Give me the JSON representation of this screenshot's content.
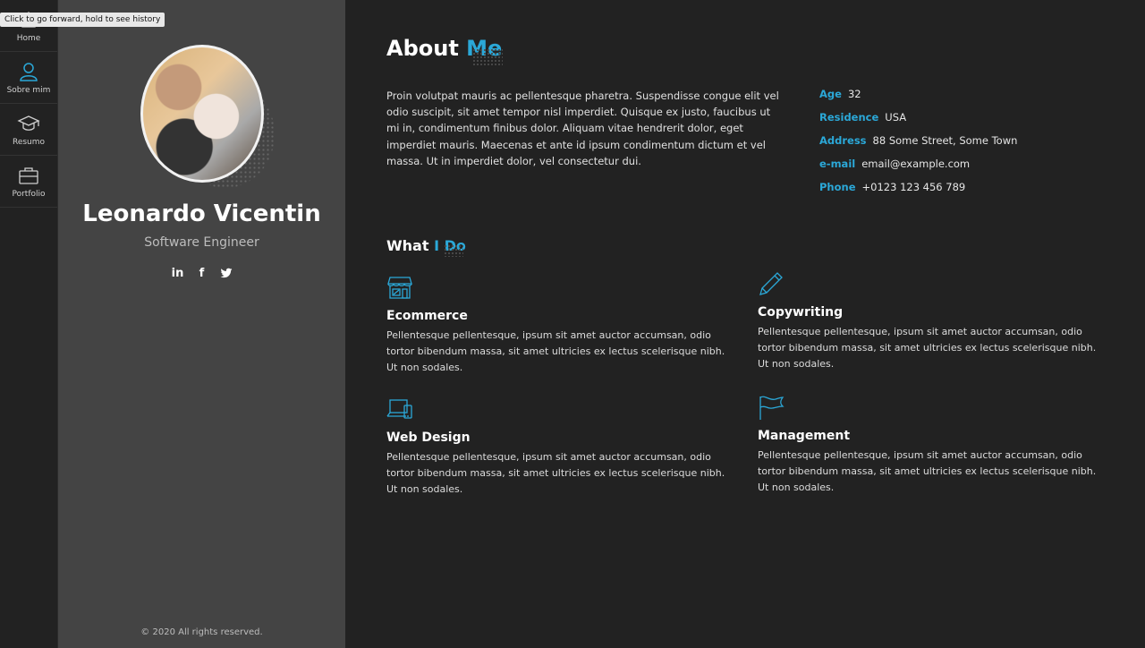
{
  "browser": {
    "tooltip": "Click to go forward, hold to see history"
  },
  "nav": {
    "items": [
      {
        "label": "Home",
        "icon": "home-icon"
      },
      {
        "label": "Sobre mim",
        "icon": "user-icon"
      },
      {
        "label": "Resumo",
        "icon": "graduation-cap-icon"
      },
      {
        "label": "Portfolio",
        "icon": "briefcase-icon"
      }
    ]
  },
  "profile": {
    "name": "Leonardo Vicentin",
    "role": "Software Engineer",
    "social": {
      "linkedin": "in",
      "facebook": "f",
      "twitter": "twitter-icon"
    },
    "copyright": "© 2020 All rights reserved."
  },
  "about": {
    "title_main": "About",
    "title_accent": "Me",
    "text": "Proin volutpat mauris ac pellentesque pharetra. Suspendisse congue elit vel odio suscipit, sit amet tempor nisl imperdiet. Quisque ex justo, faucibus ut mi in, condimentum finibus dolor. Aliquam vitae hendrerit dolor, eget imperdiet mauris. Maecenas et ante id ipsum condimentum dictum et vel massa. Ut in imperdiet dolor, vel consectetur dui.",
    "info": [
      {
        "key": "Age",
        "value": "32"
      },
      {
        "key": "Residence",
        "value": "USA"
      },
      {
        "key": "Address",
        "value": "88 Some Street, Some Town"
      },
      {
        "key": "e-mail",
        "value": "email@example.com"
      },
      {
        "key": "Phone",
        "value": "+0123 123 456 789"
      }
    ]
  },
  "what_i_do": {
    "title_main": "What",
    "title_accent": "I Do",
    "services": [
      {
        "title": "Ecommerce",
        "icon": "store-icon",
        "text": "Pellentesque pellentesque, ipsum sit amet auctor accumsan, odio tortor bibendum massa, sit amet ultricies ex lectus scelerisque nibh. Ut non sodales."
      },
      {
        "title": "Copywriting",
        "icon": "pencil-icon",
        "text": "Pellentesque pellentesque, ipsum sit amet auctor accumsan, odio tortor bibendum massa, sit amet ultricies ex lectus scelerisque nibh. Ut non sodales."
      },
      {
        "title": "Web Design",
        "icon": "devices-icon",
        "text": "Pellentesque pellentesque, ipsum sit amet auctor accumsan, odio tortor bibendum massa, sit amet ultricies ex lectus scelerisque nibh. Ut non sodales."
      },
      {
        "title": "Management",
        "icon": "flag-icon",
        "text": "Pellentesque pellentesque, ipsum sit amet auctor accumsan, odio tortor bibendum massa, sit amet ultricies ex lectus scelerisque nibh. Ut non sodales."
      }
    ]
  },
  "colors": {
    "accent": "#2ba8d8",
    "background": "#222222",
    "sidebar": "#444444"
  }
}
